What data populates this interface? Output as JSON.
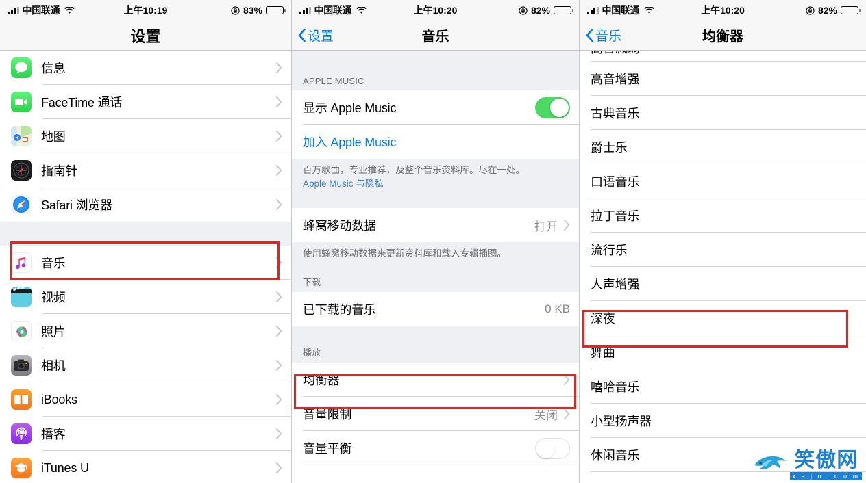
{
  "panels": [
    {
      "status": {
        "carrier": "中国联通",
        "time": "上午10:19",
        "battery_pct": "83%"
      },
      "nav": {
        "title": "设置"
      },
      "items": [
        {
          "label": "信息",
          "icon": "messages-icon"
        },
        {
          "label": "FaceTime 通话",
          "icon": "facetime-icon"
        },
        {
          "label": "地图",
          "icon": "maps-icon"
        },
        {
          "label": "指南针",
          "icon": "compass-icon"
        },
        {
          "label": "Safari 浏览器",
          "icon": "safari-icon"
        }
      ],
      "items2": [
        {
          "label": "音乐",
          "icon": "music-icon",
          "highlighted": true
        },
        {
          "label": "视频",
          "icon": "videos-icon"
        },
        {
          "label": "照片",
          "icon": "photos-icon"
        },
        {
          "label": "相机",
          "icon": "camera-icon"
        },
        {
          "label": "iBooks",
          "icon": "ibooks-icon"
        },
        {
          "label": "播客",
          "icon": "podcasts-icon"
        },
        {
          "label": "iTunes U",
          "icon": "itunesu-icon"
        }
      ]
    },
    {
      "status": {
        "carrier": "中国联通",
        "time": "上午10:20",
        "battery_pct": "82%"
      },
      "nav": {
        "back": "设置",
        "title": "音乐"
      },
      "section_apple_music": "APPLE MUSIC",
      "show_apple_music": {
        "label": "显示 Apple Music",
        "toggle": "on"
      },
      "join_apple_music": {
        "label": "加入 Apple Music"
      },
      "footer_1_text": "百万歌曲，专业推荐，及整个音乐资料库。尽在一处。",
      "footer_1_link": "Apple Music 与隐私",
      "cellular": {
        "label": "蜂窝移动数据",
        "value": "打开"
      },
      "footer_2_text": "使用蜂窝移动数据来更新资料库和载入专辑插图。",
      "section_download": "下载",
      "downloaded": {
        "label": "已下载的音乐",
        "value": "0 KB"
      },
      "section_playback": "播放",
      "equalizer": {
        "label": "均衡器",
        "highlighted": true
      },
      "volume_limit": {
        "label": "音量限制",
        "value": "关闭"
      },
      "volume_balance": {
        "label": "音量平衡",
        "toggle": "off"
      }
    },
    {
      "status": {
        "carrier": "中国联通",
        "time": "上午10:20",
        "battery_pct": "82%"
      },
      "nav": {
        "back": "音乐",
        "title": "均衡器"
      },
      "partial_top_item": "高音减弱",
      "items": [
        {
          "label": "高音增强"
        },
        {
          "label": "古典音乐"
        },
        {
          "label": "爵士乐"
        },
        {
          "label": "口语音乐"
        },
        {
          "label": "拉丁音乐"
        },
        {
          "label": "流行乐"
        },
        {
          "label": "人声增强"
        },
        {
          "label": "深夜",
          "highlighted": true
        },
        {
          "label": "舞曲"
        },
        {
          "label": "嘻哈音乐"
        },
        {
          "label": "小型扬声器"
        },
        {
          "label": "休闲音乐"
        }
      ]
    }
  ],
  "watermark": {
    "cn": "笑傲网",
    "en": "x a j n . c o m"
  },
  "colors": {
    "accent_blue": "#007aff",
    "highlight_red": "#e8231b",
    "toggle_on_green": "#4cd964",
    "separator": "#d4d4d6",
    "group_bg": "#eff0f4"
  }
}
